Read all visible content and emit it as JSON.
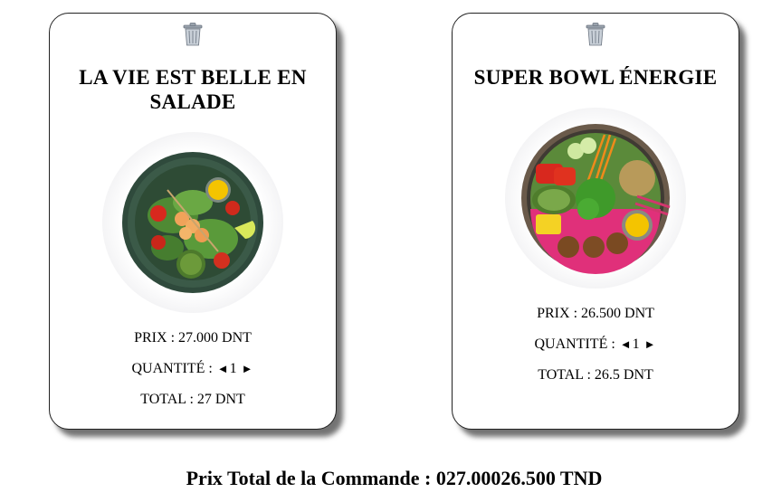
{
  "products": [
    {
      "title": "LA VIE EST BELLE EN SALADE",
      "image_icon": "salad-bowl-image",
      "prix_label": "PRIX : 27.000 DNT",
      "quantite_label": "QUANTITÉ :",
      "quantity": "1",
      "total_label": "TOTAL : 27 DNT"
    },
    {
      "title": "SUPER BOWL ÉNERGIE",
      "image_icon": "poke-bowl-image",
      "prix_label": "PRIX : 26.500 DNT",
      "quantite_label": "QUANTITÉ :",
      "quantity": "1",
      "total_label": "TOTAL : 26.5 DNT"
    }
  ],
  "arrows": {
    "decrease": "◄",
    "increase": "►"
  },
  "order": {
    "total_label": "Prix Total de la Commande : 027.00026.500 TND"
  },
  "icons": {
    "delete": "trash-icon"
  }
}
